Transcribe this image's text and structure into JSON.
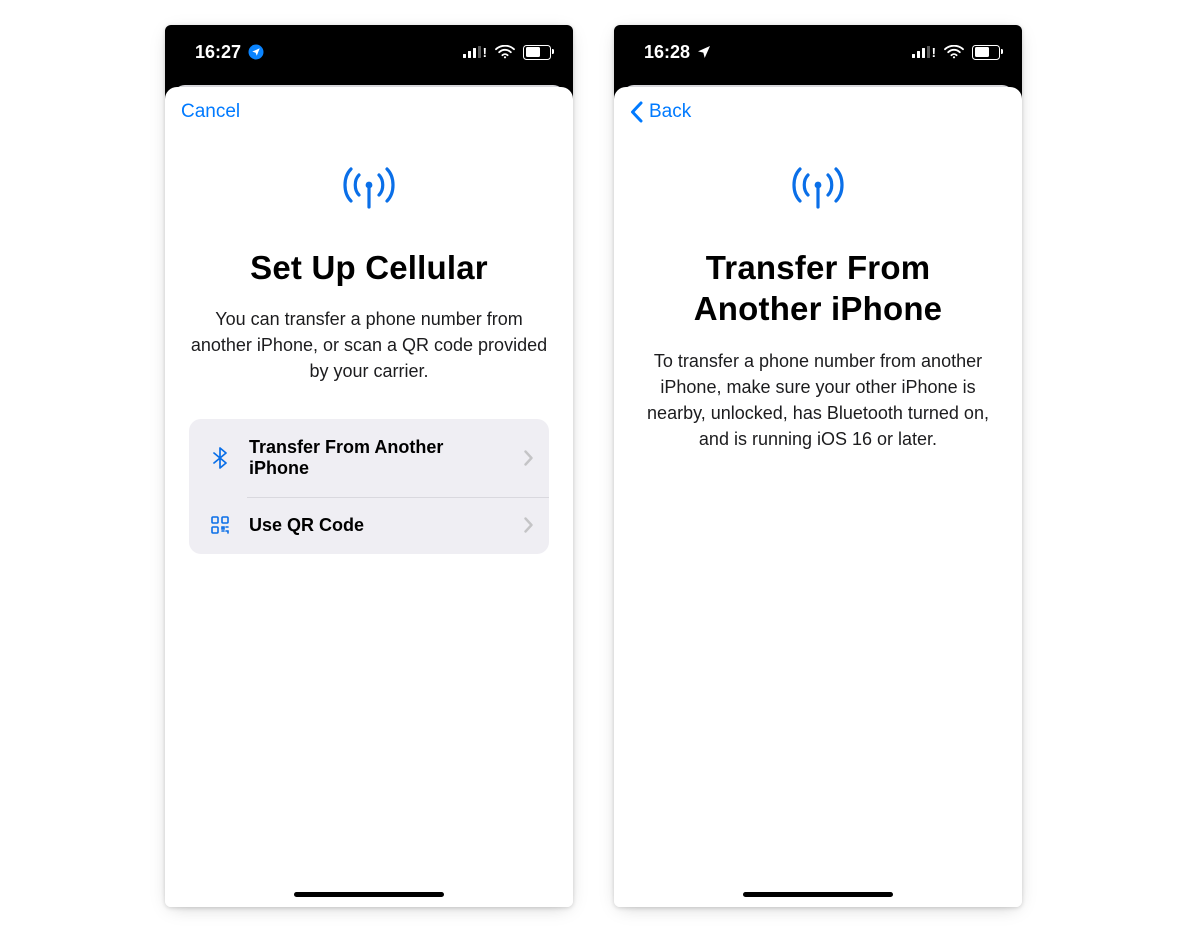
{
  "left": {
    "statusbar": {
      "time": "16:27",
      "locationBadge": true
    },
    "nav": {
      "cancel": "Cancel"
    },
    "hero": {
      "title": "Set Up Cellular",
      "subtitle": "You can transfer a phone number from another iPhone, or scan a QR code provided by your carrier."
    },
    "options": [
      {
        "icon": "bluetooth-icon",
        "label": "Transfer From Another iPhone"
      },
      {
        "icon": "qr-icon",
        "label": "Use QR Code"
      }
    ]
  },
  "right": {
    "statusbar": {
      "time": "16:28",
      "locationBadge": false
    },
    "nav": {
      "back": "Back"
    },
    "hero": {
      "title": "Transfer From Another iPhone",
      "subtitle": "To transfer a phone number from another iPhone, make sure your other iPhone is nearby, unlocked, has Bluetooth turned on, and is running iOS 16 or later."
    }
  },
  "colors": {
    "accent": "#007aff"
  }
}
